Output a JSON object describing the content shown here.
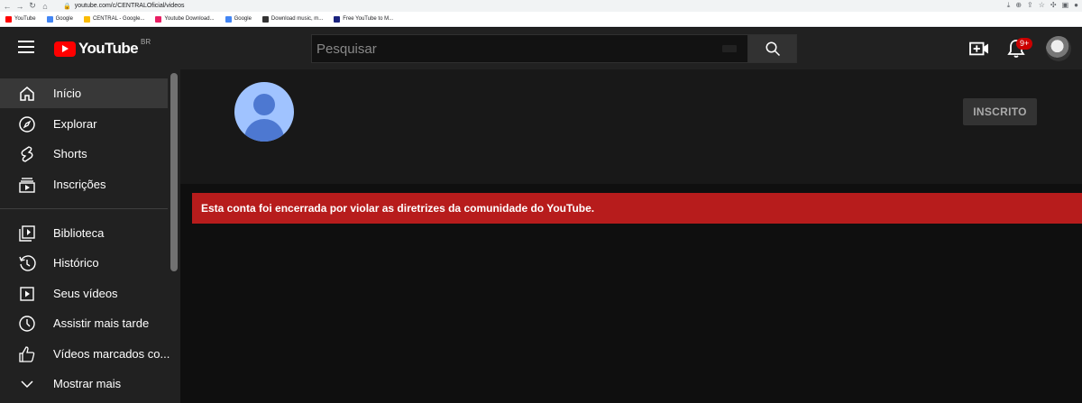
{
  "browser": {
    "url": "youtube.com/c/CENTRALOficial/videos",
    "bookmarks": [
      {
        "label": "YouTube",
        "color": "#ff0000"
      },
      {
        "label": "Google",
        "color": "#4285f4"
      },
      {
        "label": "CENTRAL - Google...",
        "color": "#fbbc04"
      },
      {
        "label": "Youtube Download...",
        "color": "#e91e63"
      },
      {
        "label": "Google",
        "color": "#4285f4"
      },
      {
        "label": "Download music, m...",
        "color": "#333333"
      },
      {
        "label": "Free YouTube to M...",
        "color": "#1a237e"
      }
    ]
  },
  "topbar": {
    "logo_text": "YouTube",
    "country_code": "BR",
    "search_placeholder": "Pesquisar",
    "notification_count": "9+"
  },
  "sidebar": {
    "items": [
      {
        "label": "Início",
        "icon": "home-icon",
        "active": true
      },
      {
        "label": "Explorar",
        "icon": "compass-icon"
      },
      {
        "label": "Shorts",
        "icon": "shorts-icon"
      },
      {
        "label": "Inscrições",
        "icon": "subscriptions-icon"
      },
      {
        "label": "Biblioteca",
        "icon": "library-icon"
      },
      {
        "label": "Histórico",
        "icon": "history-icon"
      },
      {
        "label": "Seus vídeos",
        "icon": "your-videos-icon"
      },
      {
        "label": "Assistir mais tarde",
        "icon": "watch-later-icon"
      },
      {
        "label": "Vídeos marcados co...",
        "icon": "thumbs-up-icon"
      },
      {
        "label": "Mostrar mais",
        "icon": "chevron-down-icon"
      }
    ]
  },
  "channel": {
    "subscribe_label": "INSCRITO",
    "terminated_message": "Esta conta foi encerrada por violar as diretrizes da comunidade do YouTube."
  },
  "colors": {
    "alert_bg": "#b71c1c",
    "brand_red": "#ff0000",
    "avatar_bg": "#a0c3ff"
  }
}
